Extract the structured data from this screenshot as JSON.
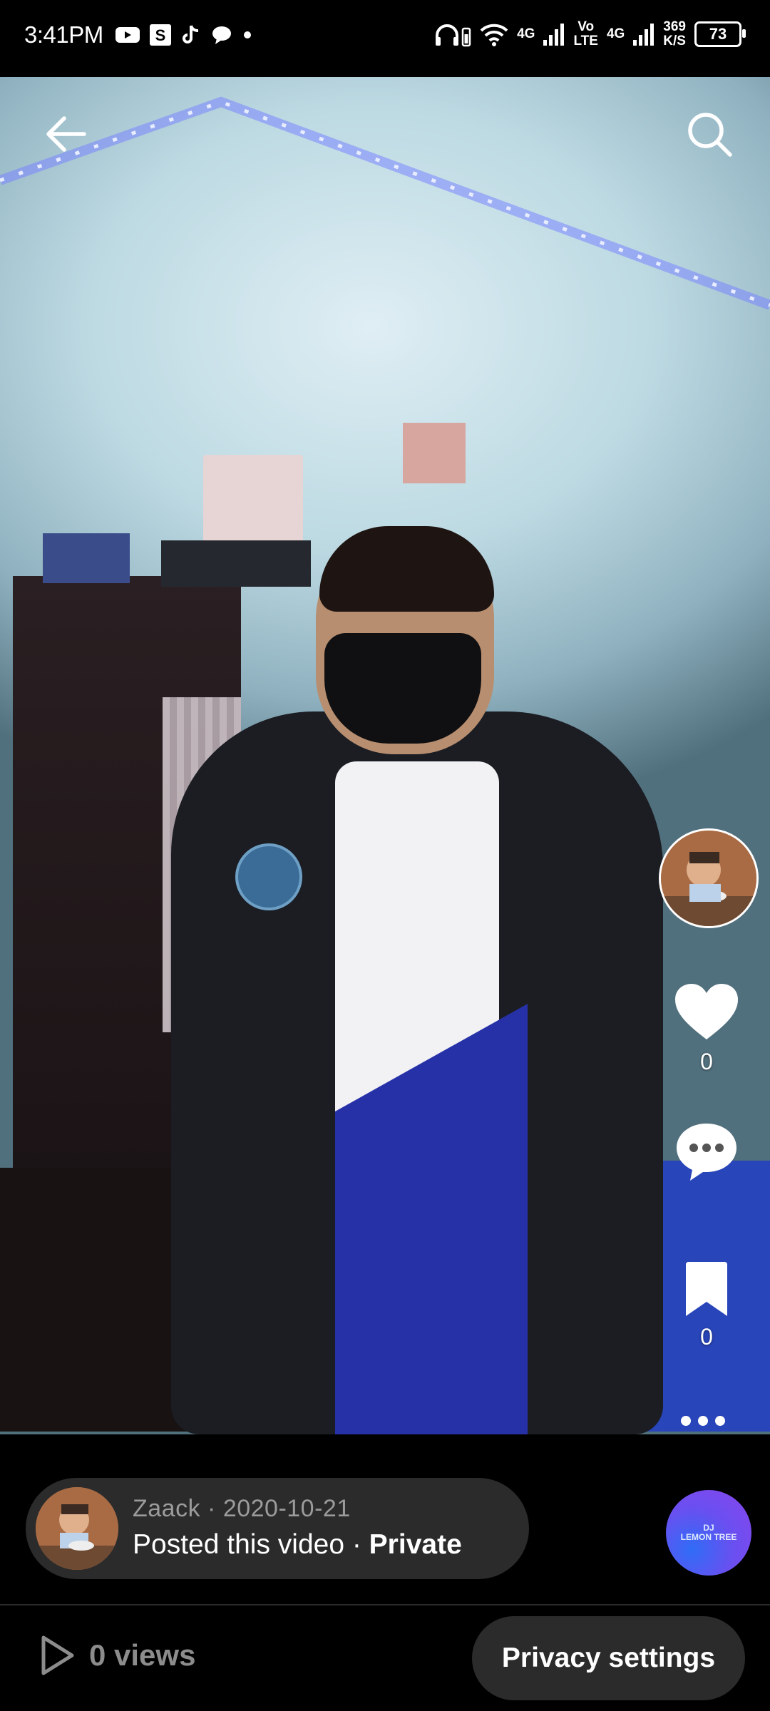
{
  "status_bar": {
    "time": "3:41PM",
    "net_speed_value": "369",
    "net_speed_unit": "K/S",
    "battery": "73",
    "network_1": "4G",
    "volte_top": "Vo",
    "volte_bottom": "LTE",
    "network_2": "4G",
    "notification_icons": [
      "youtube-icon",
      "s-app-icon",
      "tiktok-icon",
      "chat-bubble-icon",
      "dot-icon"
    ]
  },
  "top_bar": {
    "back_icon": "arrow-left-icon",
    "search_icon": "search-icon"
  },
  "right_rail": {
    "like_count": "0",
    "favorite_count": "0"
  },
  "post": {
    "author": "Zaack",
    "separator": " · ",
    "date": "2020-10-21",
    "action_text": "Posted this video · ",
    "visibility": "Private",
    "music_disc_label_top": "DJ",
    "music_disc_label": "LEMON TREE"
  },
  "footer": {
    "views": "0 views",
    "privacy_button": "Privacy settings"
  },
  "colors": {
    "background": "#000000",
    "pill": "#2b2b2b",
    "muted_text": "#9b9b9b",
    "disc_gradient_start": "#2f6cf6",
    "disc_gradient_end": "#8a46ee"
  }
}
